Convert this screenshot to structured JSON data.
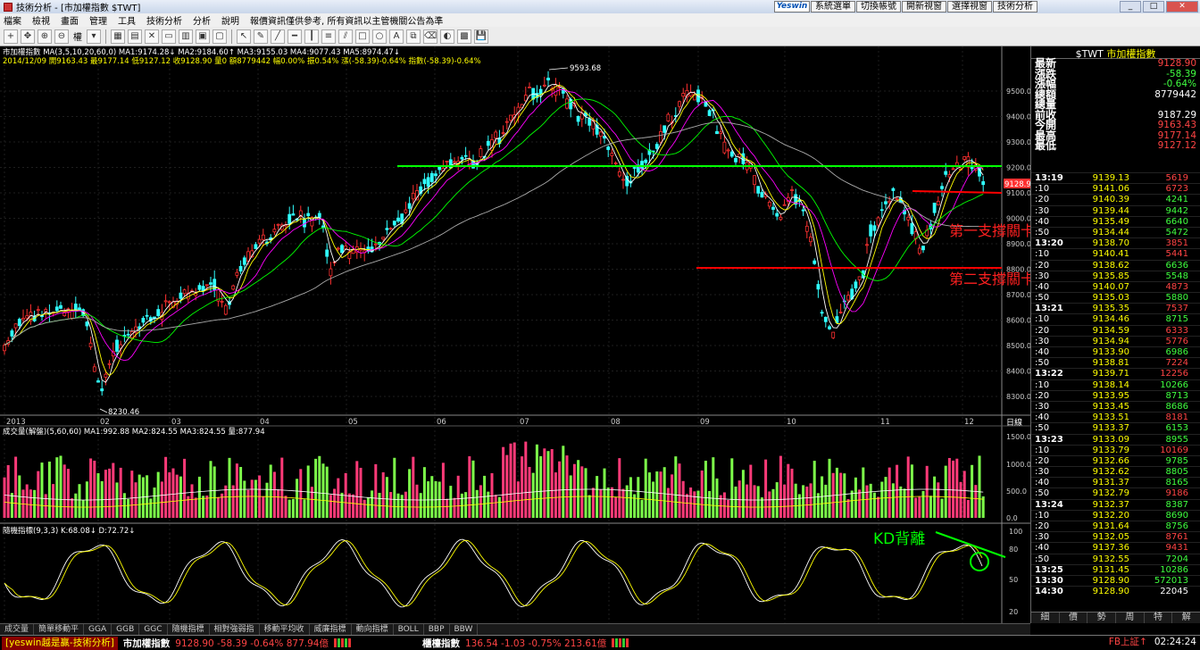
{
  "window": {
    "title": "技術分析 - [市加權指數 $TWT]",
    "min": "_",
    "max": "□",
    "close": "✕"
  },
  "menu": [
    "檔案",
    "檢視",
    "畫面",
    "管理",
    "工具",
    "技術分析",
    "分析",
    "說明",
    "報價資訊僅供參考, 所有資訊以主管機關公告為準"
  ],
  "top_buttons": {
    "brand": "Yeswin",
    "items": [
      "系統選單",
      "切換帳號",
      "開新視窗",
      "選擇視窗",
      "技術分析"
    ]
  },
  "toolbar": {
    "period_label": "權"
  },
  "main_chart": {
    "title_line1": "市加權指數  MA(3,5,10,20,60,0)  MA1:9174.28↓  MA2:9184.60↑  MA3:9155.03  MA4:9077.43  MA5:8974.47↓",
    "title_line2": "2014/12/09  開9163.43  最9177.14  低9127.12  收9128.90  量0  額8779442  幅0.00%  振0.54%  漲(-58.39)-0.64%  指數(-58.39)-0.64%",
    "y_ticks": [
      "9500.00",
      "9400.00",
      "9300.00",
      "9200.00",
      "9100.00",
      "9000.00",
      "8900.00",
      "8800.00",
      "8700.00",
      "8600.00",
      "8500.00",
      "8400.00",
      "8300.00"
    ],
    "x_ticks": [
      "2013",
      "02",
      "03",
      "04",
      "05",
      "06",
      "07",
      "08",
      "09",
      "10",
      "11",
      "12"
    ],
    "x_axis_unit": "日線",
    "high_label": "9593.68",
    "low_label": "8230.46",
    "last_price_tag": "9128.90",
    "annotation_support1": "第一支撐關卡",
    "annotation_support2": "第二支撐關卡",
    "colors": {
      "up": "#ff4040",
      "down": "#40ffff",
      "resistance": "#00ff00",
      "support": "#ff0000"
    }
  },
  "volume_chart": {
    "title": "成交量(解盤)(5,60,60)  MA1:992.88  MA2:824.55  MA3:824.55  量:877.94",
    "y_ticks": [
      "1500.0",
      "1000.0",
      "500.0",
      "0.0"
    ]
  },
  "kd_chart": {
    "title": "隨機指標(9,3,3)  K:68.08↓  D:72.72↓",
    "y_ticks": [
      "100",
      "80",
      "50",
      "20"
    ],
    "annotation": "KD背離"
  },
  "quote_panel": {
    "symbol": "$TWT",
    "name": "市加權指數",
    "rows": [
      {
        "label": "最新",
        "value": "9128.90",
        "color": "#ff4444"
      },
      {
        "label": "漲跌",
        "value": "-58.39",
        "color": "#40ff40"
      },
      {
        "label": "漲幅",
        "value": "-0.64%",
        "color": "#40ff40"
      },
      {
        "label": "總額",
        "value": "8779442",
        "color": "#ffffff"
      },
      {
        "label": "總量",
        "value": "",
        "color": "#ffffff"
      },
      {
        "label": "前收",
        "value": "9187.29",
        "color": "#ffffff"
      },
      {
        "label": "今開",
        "value": "9163.43",
        "color": "#ff4444"
      },
      {
        "label": "最高",
        "value": "9177.14",
        "color": "#ff4444"
      },
      {
        "label": "最低",
        "value": "9127.12",
        "color": "#ff4444"
      }
    ],
    "ticks": [
      {
        "t": "13:19",
        "p": "9139.13",
        "v": "5619",
        "c": "#ff4444",
        "h": true
      },
      {
        "t": ":10",
        "p": "9141.06",
        "v": "6723",
        "c": "#ff4444"
      },
      {
        "t": ":20",
        "p": "9140.39",
        "v": "4241",
        "c": "#40ff40"
      },
      {
        "t": ":30",
        "p": "9139.44",
        "v": "9442",
        "c": "#40ff40"
      },
      {
        "t": ":40",
        "p": "9135.49",
        "v": "6640",
        "c": "#40ff40"
      },
      {
        "t": ":50",
        "p": "9134.44",
        "v": "5472",
        "c": "#40ff40"
      },
      {
        "t": "13:20",
        "p": "9138.70",
        "v": "3851",
        "c": "#ff4444",
        "h": true
      },
      {
        "t": ":10",
        "p": "9140.41",
        "v": "5441",
        "c": "#ff4444"
      },
      {
        "t": ":20",
        "p": "9138.62",
        "v": "6636",
        "c": "#40ff40"
      },
      {
        "t": ":30",
        "p": "9135.85",
        "v": "5548",
        "c": "#40ff40"
      },
      {
        "t": ":40",
        "p": "9140.07",
        "v": "4873",
        "c": "#ff4444"
      },
      {
        "t": ":50",
        "p": "9135.03",
        "v": "5880",
        "c": "#40ff40"
      },
      {
        "t": "13:21",
        "p": "9135.35",
        "v": "7537",
        "c": "#ff4444",
        "h": true
      },
      {
        "t": ":10",
        "p": "9134.46",
        "v": "8715",
        "c": "#40ff40"
      },
      {
        "t": ":20",
        "p": "9134.59",
        "v": "6333",
        "c": "#ff4444"
      },
      {
        "t": ":30",
        "p": "9134.94",
        "v": "5776",
        "c": "#ff4444"
      },
      {
        "t": ":40",
        "p": "9133.90",
        "v": "6986",
        "c": "#40ff40"
      },
      {
        "t": ":50",
        "p": "9138.81",
        "v": "7224",
        "c": "#ff4444"
      },
      {
        "t": "13:22",
        "p": "9139.71",
        "v": "12256",
        "c": "#ff4444",
        "h": true
      },
      {
        "t": ":10",
        "p": "9138.14",
        "v": "10266",
        "c": "#40ff40"
      },
      {
        "t": ":20",
        "p": "9133.95",
        "v": "8713",
        "c": "#40ff40"
      },
      {
        "t": ":30",
        "p": "9133.45",
        "v": "8686",
        "c": "#40ff40"
      },
      {
        "t": ":40",
        "p": "9133.51",
        "v": "8181",
        "c": "#ff4444"
      },
      {
        "t": ":50",
        "p": "9133.37",
        "v": "6153",
        "c": "#40ff40"
      },
      {
        "t": "13:23",
        "p": "9133.09",
        "v": "8955",
        "c": "#40ff40",
        "h": true
      },
      {
        "t": ":10",
        "p": "9133.79",
        "v": "10169",
        "c": "#ff4444"
      },
      {
        "t": ":20",
        "p": "9132.66",
        "v": "9785",
        "c": "#40ff40"
      },
      {
        "t": ":30",
        "p": "9132.62",
        "v": "8805",
        "c": "#40ff40"
      },
      {
        "t": ":40",
        "p": "9131.37",
        "v": "8165",
        "c": "#40ff40"
      },
      {
        "t": ":50",
        "p": "9132.79",
        "v": "9186",
        "c": "#ff4444"
      },
      {
        "t": "13:24",
        "p": "9132.37",
        "v": "8387",
        "c": "#40ff40",
        "h": true
      },
      {
        "t": ":10",
        "p": "9132.20",
        "v": "8690",
        "c": "#40ff40"
      },
      {
        "t": ":20",
        "p": "9131.64",
        "v": "8756",
        "c": "#40ff40"
      },
      {
        "t": ":30",
        "p": "9132.05",
        "v": "8761",
        "c": "#ff4444"
      },
      {
        "t": ":40",
        "p": "9137.36",
        "v": "9431",
        "c": "#ff4444"
      },
      {
        "t": ":50",
        "p": "9132.55",
        "v": "7204",
        "c": "#40ff40"
      },
      {
        "t": "13:25",
        "p": "9131.45",
        "v": "10286",
        "c": "#40ff40",
        "h": true
      },
      {
        "t": "13:30",
        "p": "9128.90",
        "v": "572013",
        "c": "#40ff40",
        "h": true
      },
      {
        "t": "14:30",
        "p": "9128.90",
        "v": "22045",
        "c": "#ffffff",
        "h": true
      }
    ],
    "tabs": [
      "細",
      "價",
      "勢",
      "周",
      "特",
      "解"
    ]
  },
  "bottom_tabs": [
    "成交量",
    "簡單移動平",
    "GGA",
    "GGB",
    "GGC",
    "隨機指標",
    "相對強弱指",
    "移動平均收",
    "威廉指標",
    "動向指標",
    "BOLL",
    "BBP",
    "BBW"
  ],
  "status": {
    "brand": "[yeswin越是贏-技術分析]",
    "name1": "市加權指數",
    "quote1": "9128.90 -58.39 -0.64% 877.94億",
    "name2": "櫃檯指數",
    "quote2": "136.54 -1.03 -0.75% 213.61億",
    "market": "FB上証↑",
    "time": "02:24:24"
  }
}
